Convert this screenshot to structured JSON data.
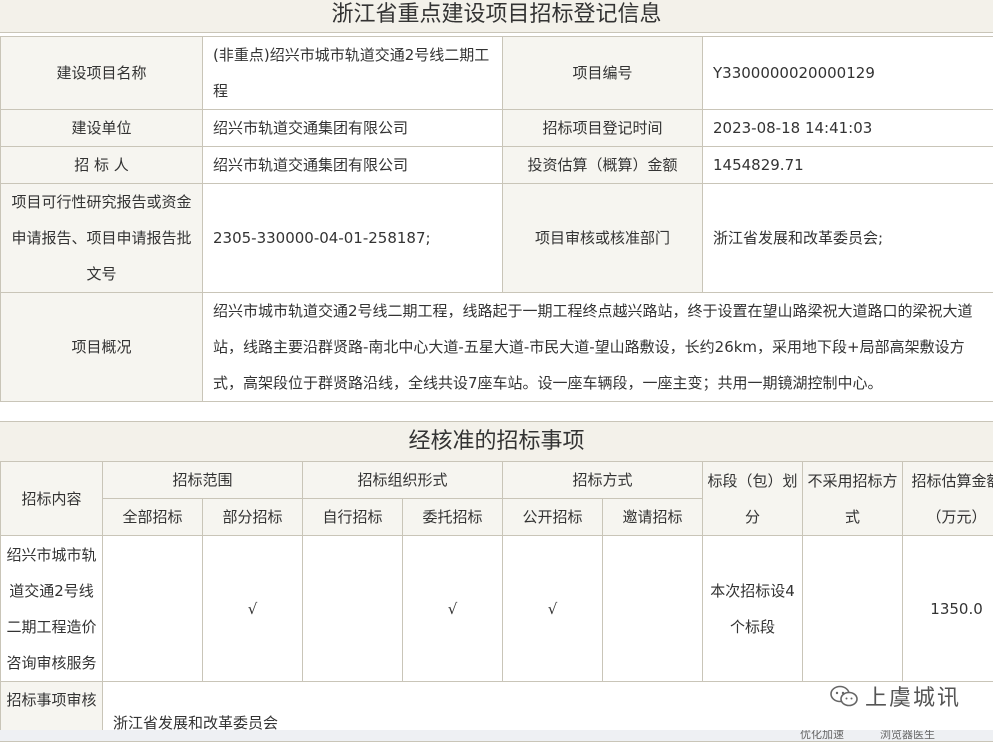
{
  "page_title": "浙江省重点建设项目招标登记信息",
  "info": {
    "project_name_label": "建设项目名称",
    "project_name": "(非重点)绍兴市城市轨道交通2号线二期工程",
    "project_no_label": "项目编号",
    "project_no": "Y3300000020000129",
    "unit_label": "建设单位",
    "unit": "绍兴市轨道交通集团有限公司",
    "reg_time_label": "招标项目登记时间",
    "reg_time": "2023-08-18 14:41:03",
    "tenderer_label": "招 标 人",
    "tenderer": "绍兴市轨道交通集团有限公司",
    "invest_label": "投资估算（概算）金额",
    "invest": "1454829.71",
    "approval_doc_label": "项目可行性研究报告或资金申请报告、项目申请报告批文号",
    "approval_doc": "2305-330000-04-01-258187;",
    "approval_dept_label": "项目审核或核准部门",
    "approval_dept": "浙江省发展和改革委员会;",
    "overview_label": "项目概况",
    "overview": "绍兴市城市轨道交通2号线二期工程，线路起于一期工程终点越兴路站，终于设置在望山路梁祝大道路口的梁祝大道站，线路主要沿群贤路-南北中心大道-五星大道-市民大道-望山路敷设，长约26km，采用地下段+局部高架敷设方式，高架段位于群贤路沿线，全线共设7座车站。设一座车辆段，一座主变；共用一期镜湖控制中心。"
  },
  "section2_title": "经核准的招标事项",
  "bid": {
    "content_label": "招标内容",
    "scope_label": "招标范围",
    "scope_all": "全部招标",
    "scope_part": "部分招标",
    "org_label": "招标组织形式",
    "org_self": "自行招标",
    "org_entrust": "委托招标",
    "method_label": "招标方式",
    "method_open": "公开招标",
    "method_invite": "邀请招标",
    "section_label": "标段（包）划分",
    "no_bid_label": "不采用招标方式",
    "amount_label": "招标估算金额（万元）",
    "row": {
      "content": "绍兴市城市轨道交通2号线二期工程造价咨询审核服务",
      "scope_all": "",
      "scope_part": "√",
      "org_self": "",
      "org_entrust": "√",
      "method_open": "√",
      "method_invite": "",
      "section": "本次招标设4个标段",
      "no_bid": "",
      "amount": "1350.0"
    },
    "audit_label": "招标事项审核",
    "audit_value": "浙江省发展和改革委员会"
  },
  "watermark": {
    "text": "上虞城讯",
    "icon": "wechat-icon"
  },
  "statusbar": {
    "item1": "优化加速",
    "item2": "浏览器医生"
  }
}
